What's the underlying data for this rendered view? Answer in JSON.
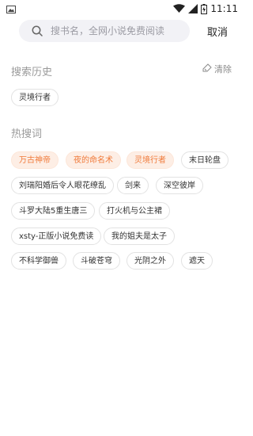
{
  "status_bar": {
    "time": "11:11"
  },
  "search": {
    "placeholder": "搜书名，全网小说免费阅读",
    "value": "",
    "cancel_label": "取消"
  },
  "history": {
    "title": "搜索历史",
    "clear_label": "清除",
    "items": [
      "灵境行者"
    ]
  },
  "hot": {
    "title": "热搜词",
    "items": [
      "万古神帝",
      "夜的命名术",
      "灵境行者",
      "末日轮盘",
      "刘瑞阳婚后令人眼花缭乱",
      "剑来",
      "深空彼岸",
      "斗罗大陆5重生唐三",
      "打火机与公主裙",
      "xsty-正版小说免费读",
      "我的姐夫是太子",
      "不科学御兽",
      "斗破苍穹",
      "光阴之外",
      "遮天"
    ],
    "highlight_color": "#f07a3a"
  }
}
